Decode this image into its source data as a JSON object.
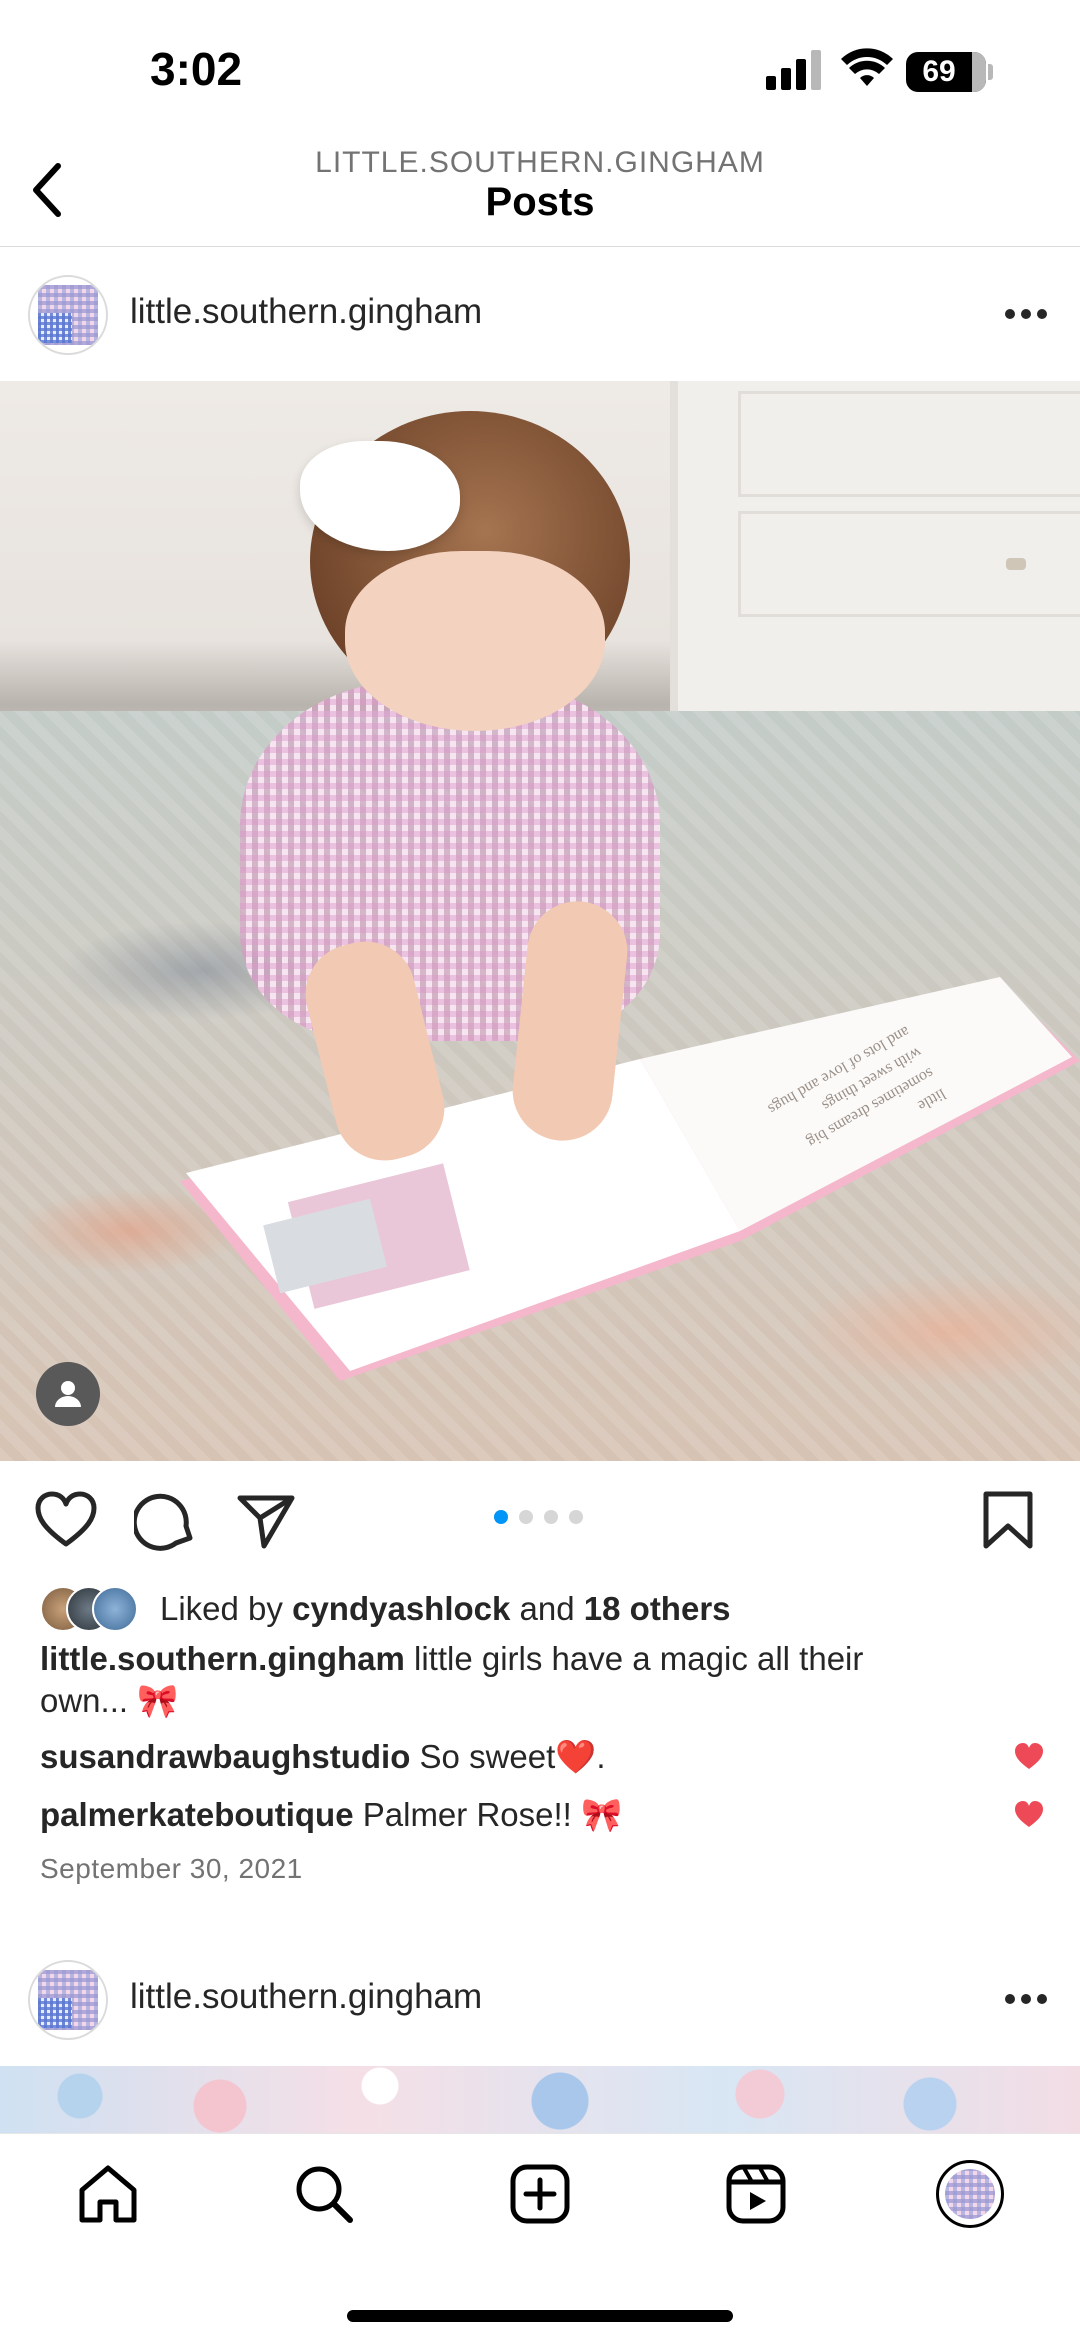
{
  "status_bar": {
    "time": "3:02",
    "battery": "69",
    "battery_level": 0.69,
    "icons": [
      "signal-icon",
      "wifi-icon",
      "battery-icon"
    ]
  },
  "nav": {
    "back_icon": "chevron-left-icon",
    "account_label": "LITTLE.SOUTHERN.GINGHAM",
    "title": "Posts"
  },
  "post": {
    "username": "little.southern.gingham",
    "more_icon": "more-horizontal-icon",
    "carousel": {
      "count": 4,
      "active_index": 0,
      "active_color": "#0095f6",
      "inactive_color": "#d6d6d6"
    },
    "photo_book_text": [
      "little",
      "sometimes dreams big",
      "with sweet things",
      "and lots of love and hugs"
    ],
    "likes": {
      "prefix": "Liked by",
      "user": "cyndyashlock",
      "joiner": "and",
      "others": "18 others"
    },
    "caption": {
      "user": "little.southern.gingham",
      "text": "little girls have a magic all their",
      "text2": "own... 🎀"
    },
    "comments": [
      {
        "user": "susandrawbaughstudio",
        "text": "So sweet❤️."
      },
      {
        "user": "palmerkateboutique",
        "text": "Palmer Rose!! 🎀"
      }
    ],
    "date": "September 30, 2021"
  },
  "post2": {
    "username": "little.southern.gingham"
  },
  "colors": {
    "like_heart": "#ed4956",
    "text": "#262626",
    "muted": "#737373"
  },
  "tabs": [
    "home-icon",
    "search-icon",
    "create-icon",
    "reels-icon",
    "profile-icon"
  ]
}
